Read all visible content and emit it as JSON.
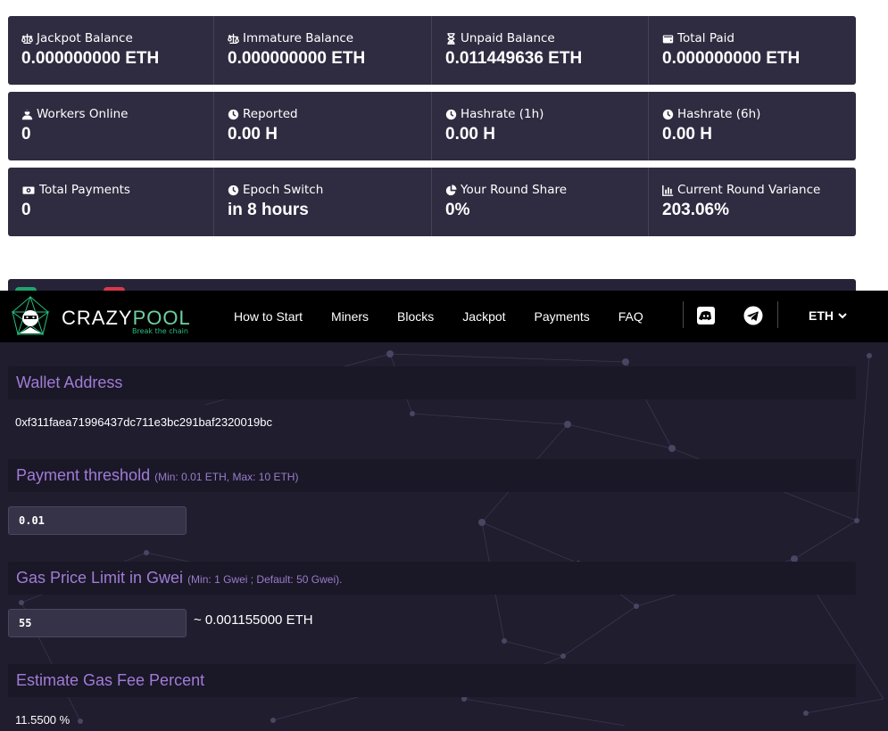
{
  "stats": {
    "row1": [
      {
        "icon": "balance-scale-icon",
        "label": "Jackpot Balance",
        "value": "0.000000000 ETH"
      },
      {
        "icon": "balance-scale-left-icon",
        "label": "Immature Balance",
        "value": "0.000000000 ETH"
      },
      {
        "icon": "hourglass-icon",
        "label": "Unpaid Balance",
        "value": "0.011449636 ETH"
      },
      {
        "icon": "wallet-icon",
        "label": "Total Paid",
        "value": "0.000000000 ETH"
      }
    ],
    "row2": [
      {
        "icon": "workers-icon",
        "label": "Workers Online",
        "value": "0"
      },
      {
        "icon": "clock-icon",
        "label": "Reported",
        "value": "0.00 H"
      },
      {
        "icon": "clock-icon",
        "label": "Hashrate (1h)",
        "value": "0.00 H"
      },
      {
        "icon": "clock-icon",
        "label": "Hashrate (6h)",
        "value": "0.00 H"
      }
    ],
    "row3": [
      {
        "icon": "money-bill-icon",
        "label": "Total Payments",
        "value": "0"
      },
      {
        "icon": "clock-icon",
        "label": "Epoch Switch",
        "value": "in 8 hours"
      },
      {
        "icon": "pie-chart-icon",
        "label": "Your Round Share",
        "value": "0%"
      },
      {
        "icon": "bar-chart-icon",
        "label": "Current Round Variance",
        "value": "203.06%"
      }
    ]
  },
  "navbar": {
    "logo_text_main": "CRAZY",
    "logo_text_accent": "POOL",
    "logo_tagline": "Break the chain",
    "links": [
      "How to Start",
      "Miners",
      "Blocks",
      "Jackpot",
      "Payments",
      "FAQ"
    ],
    "social_icons": [
      "discord-icon",
      "telegram-icon"
    ],
    "currency": "ETH"
  },
  "settings": {
    "wallet": {
      "title": "Wallet Address",
      "value": "0xf311faea71996437dc711e3bc291baf2320019bc"
    },
    "payment_threshold": {
      "title": "Payment threshold",
      "hint": "(Min: 0.01 ETH, Max: 10 ETH)",
      "value": "0.01"
    },
    "gas_price": {
      "title": "Gas Price Limit in Gwei",
      "hint": "(Min: 1 Gwei ; Default: 50 Gwei).",
      "value": "55",
      "eth_equivalent": "~ 0.001155000 ETH"
    },
    "gas_fee": {
      "title": "Estimate Gas Fee Percent",
      "value": "11.5500 %"
    }
  },
  "colors": {
    "stat_card_bg": "#2f2c41",
    "navbar_bg": "#000000",
    "settings_bg": "#201d2e",
    "section_header_bg": "#1a1727",
    "section_title": "#a07cd6",
    "logo_accent": "#6fd0a0"
  }
}
